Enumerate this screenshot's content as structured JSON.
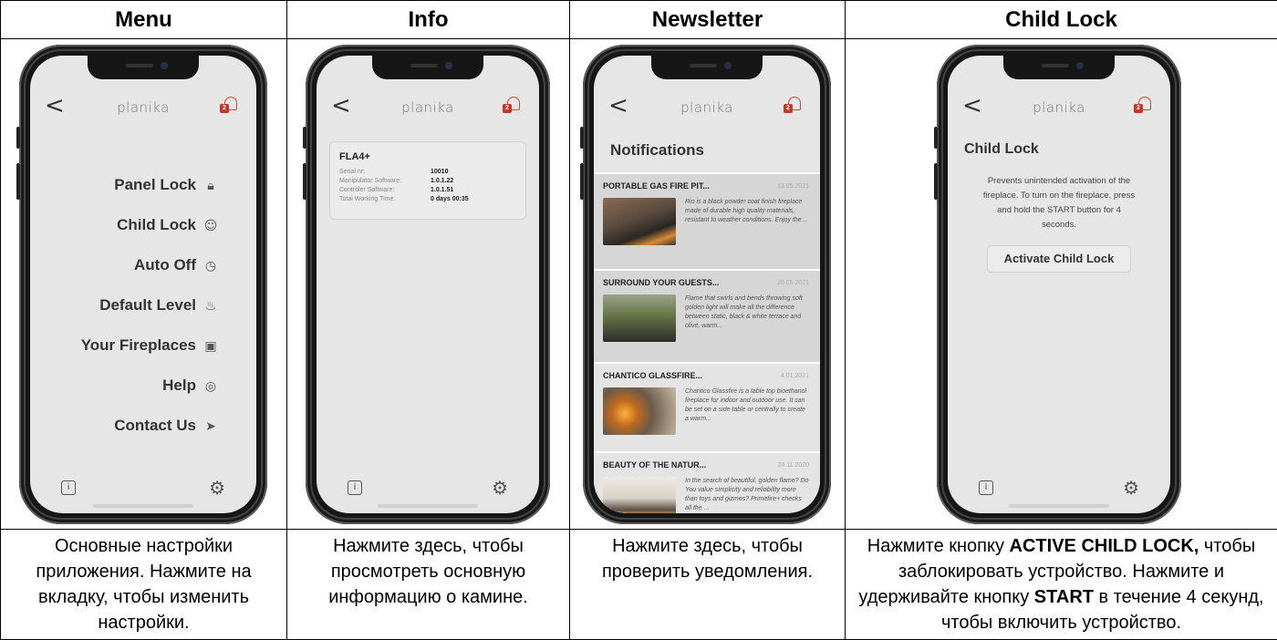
{
  "headers": [
    "Menu",
    "Info",
    "Newsletter",
    "Child Lock"
  ],
  "app": {
    "logo": "planika",
    "back": "<",
    "badge": "2"
  },
  "menu": {
    "items": [
      {
        "label": "Panel Lock",
        "icon": "padlock-icon"
      },
      {
        "label": "Child Lock",
        "icon": "child-lock-icon"
      },
      {
        "label": "Auto Off",
        "icon": "clock-icon"
      },
      {
        "label": "Default Level",
        "icon": "flame-icon"
      },
      {
        "label": "Your Fireplaces",
        "icon": "fireplace-icon"
      },
      {
        "label": "Help",
        "icon": "lifebuoy-icon"
      },
      {
        "label": "Contact Us",
        "icon": "send-icon"
      }
    ]
  },
  "info": {
    "device": "FLA4+",
    "rows": [
      {
        "label": "Serial nr:",
        "value": "10010"
      },
      {
        "label": "Manipulator Software:",
        "value": "1.0.1.22"
      },
      {
        "label": "Controler Software:",
        "value": "1.0.1.51"
      },
      {
        "label": "Total Working Time:",
        "value": "0 days  00:35"
      }
    ]
  },
  "newsletter": {
    "title": "Notifications",
    "items": [
      {
        "title": "PORTABLE GAS FIRE PIT...",
        "date": "13.05.2021",
        "text": "Rio is a black powder coat finish fireplace made of durable high quality materials, resistant to weather conditions. Enjoy the..."
      },
      {
        "title": "SURROUND YOUR GUESTS...",
        "date": "20.05.2021",
        "text": "Flame that swirls and bends throwing soft golden light will make all the difference between static, black & white terrace and olive, warm..."
      },
      {
        "title": "CHANTICO GLASSFIRE...",
        "date": "4.01.2021",
        "text": "Chantico Glassfire is a table top bioethanol fireplace for indoor and outdoor use. It can be set on a side table or centrally to create a warm..."
      },
      {
        "title": "BEAUTY OF THE NATUR...",
        "date": "24.11.2020",
        "text": "In the search of beautiful, golden flame? Do You value simplicity and reliability more than toys and gizmos? Primefire+ checks all the ..."
      }
    ]
  },
  "childlock": {
    "title": "Child Lock",
    "description": "Prevents unintended activation of the fireplace. To turn on the fireplace, press and hold the START button for 4 seconds.",
    "button": "Activate Child Lock"
  },
  "captions": {
    "menu": "Основные настройки приложения. Нажмите на вкладку, чтобы изменить настройки.",
    "info": "Нажмите здесь, чтобы просмотреть основную информацию о камине.",
    "newsletter": "Нажмите здесь, чтобы проверить уведомления.",
    "childlock": {
      "p1": "Нажмите кнопку ",
      "b1": "ACTIVE CHILD LOCK,",
      "p2": " чтобы заблокировать устройство. Нажмите и удерживайте кнопку ",
      "b2": "START",
      "p3": " в течение 4 секунд, чтобы включить устройство."
    }
  }
}
